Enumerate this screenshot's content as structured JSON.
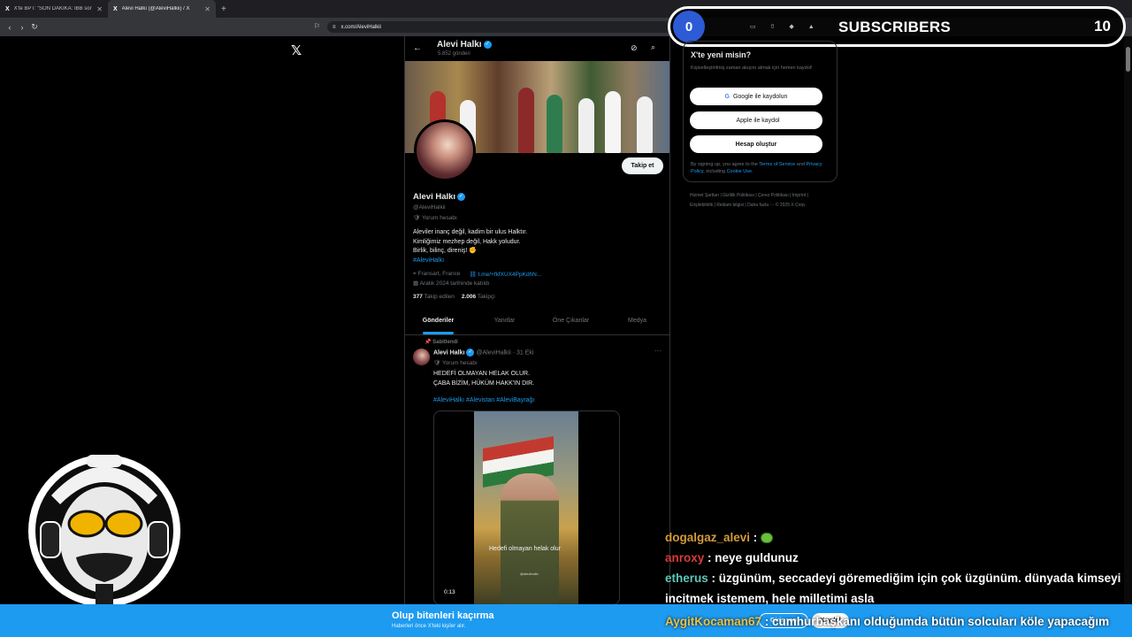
{
  "browser": {
    "tabs": [
      {
        "title": "X'te BPT: \"SON DAKİKA: İBB sorugtu...",
        "active": false
      },
      {
        "title": "Alevi Halkı (@AleviHalkii) / X",
        "active": true
      }
    ],
    "new_tab": "+",
    "url": "x.com/AleviHalkii"
  },
  "subs": {
    "number": "0",
    "label": "SUBSCRIBERS",
    "count": "10"
  },
  "x_logo": "𝕏",
  "header": {
    "name": "Alevi Halkı",
    "posts": "5.852 gönderi"
  },
  "profile": {
    "follow_button": "Takip et",
    "name": "Alevi Halkı",
    "handle": "@AleviHalkii",
    "category": "Yorum hesabı",
    "bio_lines": [
      "Aleviler inanç değil, kadim bir ulus Halktır.",
      "Kimliğimiz mezhep değil, Hakk yoludur.",
      "Birlik, bilinç, direniş! ✊"
    ],
    "bio_tag": "#AleviHalkı",
    "location": "Fransart, France",
    "link": "t.me/+fkfXUX4PpKdhN...",
    "joined": "Aralık 2024 tarihinde katıldı",
    "following_count": "377",
    "following_label": "Takip edilen",
    "followers_count": "2.006",
    "followers_label": "Takipçi"
  },
  "tabs": [
    "Gönderiler",
    "Yanıtlar",
    "Öne Çıkanlar",
    "Medya"
  ],
  "tweet": {
    "pinned": "Sabitlendi",
    "name": "Alevi Halkı",
    "handle": "@AleviHalkii · 31 Eki",
    "category": "Yorum hesabı",
    "text_lines": [
      "HEDEFİ OLMAYAN HELAK OLUR.",
      "ÇABA BİZİM, HÜKÜM HAKK'IN DIR."
    ],
    "tags": "#AleviHalkı #Alevistan #AleviBayrağı",
    "media_caption": "Hedefi olmayan helak olur",
    "media_small": "@alevihalkı",
    "duration": "0:13"
  },
  "signup": {
    "title": "X'te yeni misin?",
    "desc": "Kişiselleştirilmiş zaman akışını almak için hemen kaydol!",
    "google": "Google ile kaydolun",
    "apple": "Apple ile kaydol",
    "create": "Hesap oluştur",
    "fine_prefix": "By signing up, you agree to the ",
    "terms": "Terms of Service",
    "and": " and ",
    "privacy": "Privacy Policy",
    "including": ", including ",
    "cookie": "Cookie Use."
  },
  "footer": "Hizmet Şartları | Gizlilik Politikası | Çerez Politikası | Imprint | Erişilebilirlik | Reklam bilgisi | Daha fazla ··· © 2025 X Corp.",
  "chat": [
    {
      "user": "dogalgaz_alevi",
      "text": "",
      "emote": "frog"
    },
    {
      "user": "anroxy",
      "text": "neye guldunuz"
    },
    {
      "user": "etherus",
      "text": "üzgünüm, seccadeyi göremediğim için çok üzgünüm. dünyada kimseyi incitmek istemem, hele milletimi asla"
    }
  ],
  "chat_last": {
    "user": "AygitKocaman67",
    "text": "cumhurbaşkanı olduğumda bütün solcuları köle yapacağım"
  },
  "bottom_banner": {
    "title": "Olup bitenleri kaçırma",
    "subtitle": "Haberleri önce X'teki kişiler alır.",
    "login": "Giriş yap",
    "signup": "Kaydol"
  },
  "colors": {
    "accent": "#1d9bf0",
    "background": "#000000"
  }
}
